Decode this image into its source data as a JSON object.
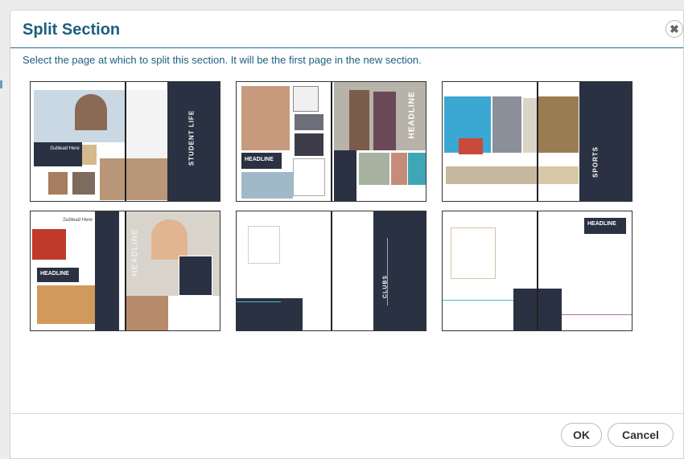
{
  "dialog": {
    "title": "Split Section",
    "instructions": "Select the page at which to split this section. It will be the first page in the new section."
  },
  "thumbnails": [
    {
      "spine_text": "STUDENT LIFE",
      "script_text": "Sublead Here"
    },
    {
      "headline": "HEADLINE",
      "vertical_text": "HEADLINE"
    },
    {
      "spine_text": "SPORTS"
    },
    {
      "headline": "HEADLINE",
      "vertical_text": "HEADLINE",
      "script_text": "Sublead Here"
    },
    {
      "spine_text": "CLUBS"
    },
    {
      "headline": "HEADLINE"
    }
  ],
  "footer": {
    "ok_label": "OK",
    "cancel_label": "Cancel"
  },
  "colors": {
    "accent": "#1c5f80",
    "navy": "#2a3142"
  },
  "icons": {
    "close": "close-icon"
  }
}
